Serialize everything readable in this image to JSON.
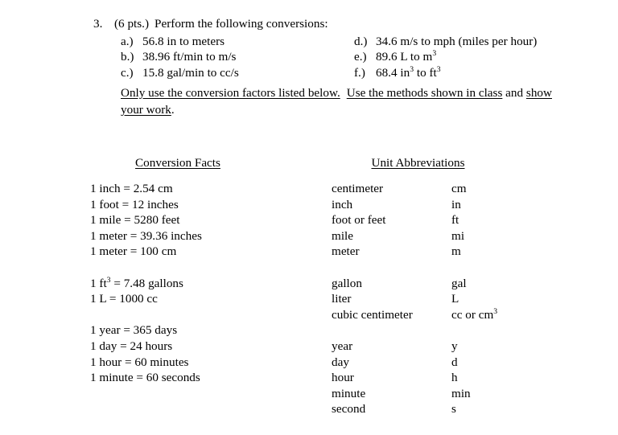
{
  "document": {
    "clipped_top_text": "",
    "question": {
      "number": "3.",
      "points": "(6 pts.)",
      "prompt": "Perform the following conversions:",
      "items_left": [
        {
          "label": "a.)",
          "text": "56.8 in to meters"
        },
        {
          "label": "b.)",
          "text": "38.96 ft/min to m/s"
        },
        {
          "label": "c.)",
          "text": "15.8 gal/min to cc/s"
        }
      ],
      "items_right": [
        {
          "label": "d.)",
          "text": "34.6 m/s to mph (miles per hour)",
          "sup": ""
        },
        {
          "label": "e.)",
          "text": "89.6 L to m",
          "sup": "3"
        },
        {
          "label": "f.)",
          "text_pre": "68.4 in",
          "sup1": "3",
          "text_mid": " to ft",
          "sup2": "3"
        }
      ]
    },
    "instructions": {
      "underlined_1": "Only use the conversion factors listed below.",
      "underlined_2": "Use the methods shown in class",
      "plain_1": "and",
      "underlined_3": "show your work",
      "plain_2": "."
    },
    "facts": {
      "heading": "Conversion Facts",
      "groups": [
        {
          "lines": [
            "1 inch = 2.54 cm",
            "1 foot = 12 inches",
            "1 mile = 5280 feet",
            "1 meter = 39.36 inches",
            "1 meter = 100 cm"
          ]
        },
        {
          "lines_special": [
            {
              "pre": "1 ft",
              "sup": "3",
              "post": " = 7.48 gallons"
            }
          ],
          "lines": [
            "1 L = 1000 cc"
          ]
        },
        {
          "lines": [
            "1 year = 365 days",
            "1 day = 24 hours",
            "1 hour = 60 minutes",
            "1 minute = 60 seconds"
          ]
        }
      ]
    },
    "abbreviations": {
      "heading": "Unit Abbreviations",
      "groups": [
        {
          "rows": [
            {
              "name": "centimeter",
              "symbol": "cm"
            },
            {
              "name": "inch",
              "symbol": "in"
            },
            {
              "name": "foot or feet",
              "symbol": "ft"
            },
            {
              "name": "mile",
              "symbol": "mi"
            },
            {
              "name": "meter",
              "symbol": "m"
            }
          ]
        },
        {
          "rows": [
            {
              "name": "gallon",
              "symbol": "gal"
            },
            {
              "name": "liter",
              "symbol": "L"
            },
            {
              "name": "cubic centimeter",
              "symbol": "cc or cm",
              "symbol_sup": "3"
            }
          ]
        },
        {
          "rows": [
            {
              "name": "year",
              "symbol": "y"
            },
            {
              "name": "day",
              "symbol": "d"
            },
            {
              "name": "hour",
              "symbol": "h"
            },
            {
              "name": "minute",
              "symbol": "min"
            },
            {
              "name": "second",
              "symbol": "s"
            }
          ]
        }
      ]
    }
  }
}
